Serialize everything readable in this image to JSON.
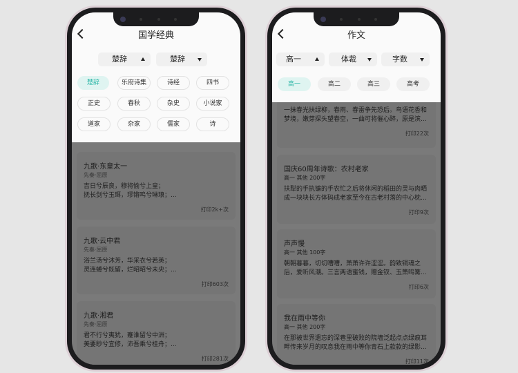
{
  "left": {
    "title": "国学经典",
    "dropdowns": [
      "楚辞",
      "楚辞"
    ],
    "chips": [
      "楚辞",
      "乐府诗集",
      "诗经",
      "四书",
      "正史",
      "春秋",
      "杂史",
      "小说家",
      "道家",
      "杂家",
      "儒家",
      "诗"
    ],
    "active_chip": "楚辞",
    "cards": [
      {
        "title": "九歌·东皇太一",
        "meta": "先秦·屈原",
        "lines": [
          "吉日兮辰良，穆将愉兮上皇；",
          "抚长剑兮玉珥，璆锵鸣兮琳琅；..."
        ],
        "print": "打印2k+次"
      },
      {
        "title": "九歌·云中君",
        "meta": "先秦·屈原",
        "lines": [
          "浴兰汤兮沐芳，华采衣兮若英；",
          "灵连蜷兮既留，烂昭昭兮未央；..."
        ],
        "print": "打印603次"
      },
      {
        "title": "九歌·湘君",
        "meta": "先秦·屈原",
        "lines": [
          "君不行兮夷犹，蹇谁留兮中洲；",
          "美要眇兮宜修，沛吾乘兮桂舟；..."
        ],
        "print": "打印281次"
      }
    ]
  },
  "right": {
    "title": "作文",
    "dropdowns": [
      "高一",
      "体裁",
      "字数"
    ],
    "chips": [
      "高一",
      "高二",
      "高三",
      "高考"
    ],
    "active_chip": "高一",
    "first_card": {
      "lines": [
        "一抹春光扶绿柳，春雨、春雷争先恐后。鸟语花香和",
        "梦境，嫩芽探头望春空，一曲可将催心醉，原是滨..."
      ],
      "print": "打印22次"
    },
    "cards": [
      {
        "title": "国庆60周年诗歌：农村老家",
        "meta": "高一 其他 200字",
        "lines": [
          "扶犁的手执镰的手农忙之后将休闲的稻田的灵与肉晒",
          "成一块块长方体码成老家至今在古老村落的中心枕..."
        ],
        "print": "打印9次"
      },
      {
        "title": "声声慢",
        "meta": "高一 其他 100字",
        "lines": [
          "朝朝暮暮，切切嘈嘈，萧萧许许涩涩。韵致铜魂之",
          "后，爱听风潮。三言两语蜜钱，赠金钗、玉箫鸣篝..."
        ],
        "print": "打印6次"
      },
      {
        "title": "我在雨中等你",
        "meta": "高一 其他 200字",
        "lines": [
          "在那被世界遗忘的深巷里破败的院墙泛起点点绿痕耳",
          "畔传来岁月的叹息我在雨中等你青石上款款的绿影..."
        ],
        "print": "打印11次"
      }
    ]
  }
}
